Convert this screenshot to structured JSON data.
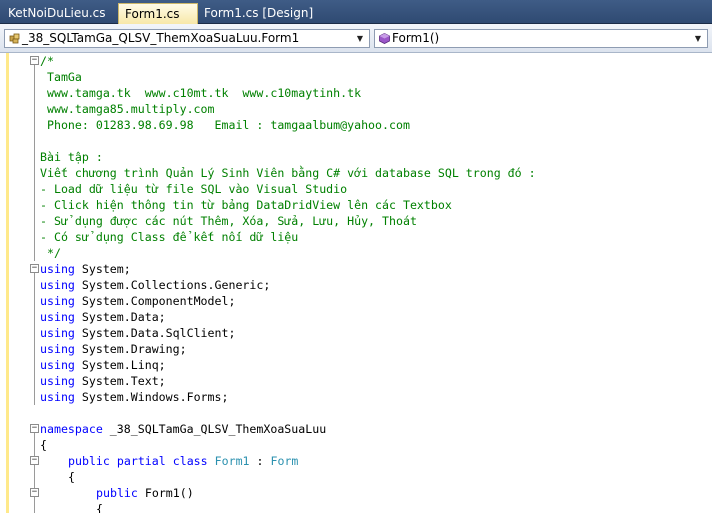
{
  "tabs": [
    {
      "label": "KetNoiDuLieu.cs",
      "active": false
    },
    {
      "label": "Form1.cs",
      "active": true
    },
    {
      "label": "Form1.cs [Design]",
      "active": false
    }
  ],
  "navbar": {
    "types_value": "_38_SQLTamGa_QLSV_ThemXoaSuaLuu.Form1",
    "members_value": "Form1()"
  },
  "code": {
    "comment_lines": [
      "/*",
      " TamGa",
      " www.tamga.tk  www.c10mt.tk  www.c10maytinh.tk",
      " www.tamga85.multiply.com",
      " Phone: 01283.98.69.98   Email : tamgaalbum@yahoo.com",
      "",
      "Bài tập :",
      "Viết chương trình Quản Lý Sinh Viên bằng C# với database SQL trong đó :",
      "- Load dữ liệu từ file SQL vào Visual Studio",
      "- Click hiện thông tin từ bảng DataDridView lên các Textbox",
      "- Sử dụng được các nút Thêm, Xóa, Sửa, Lưu, Hủy, Thoát",
      "- Có sử dụng Class để kết nối dữ liệu",
      " */"
    ],
    "using_keyword": "using",
    "usings": [
      "System;",
      "System.Collections.Generic;",
      "System.ComponentModel;",
      "System.Data;",
      "System.Data.SqlClient;",
      "System.Drawing;",
      "System.Linq;",
      "System.Text;",
      "System.Windows.Forms;"
    ],
    "namespace_keyword": "namespace",
    "namespace_name": " _38_SQLTamGa_QLSV_ThemXoaSuaLuu",
    "brace_open": "{",
    "class_public": "public",
    "class_partial": "partial",
    "class_keyword": "class",
    "class_name": "Form1",
    "class_colon": " : ",
    "class_base": "Form",
    "ctor_public": "public",
    "ctor_sig": " Form1()"
  },
  "colors": {
    "comment": "#008000",
    "keyword": "#0000ff",
    "type": "#2b91af",
    "tab_strip": "#2f4a72",
    "active_tab": "#f7e8a8"
  },
  "icons": {
    "types_combo": "class-icon",
    "members_combo": "method-icon"
  }
}
